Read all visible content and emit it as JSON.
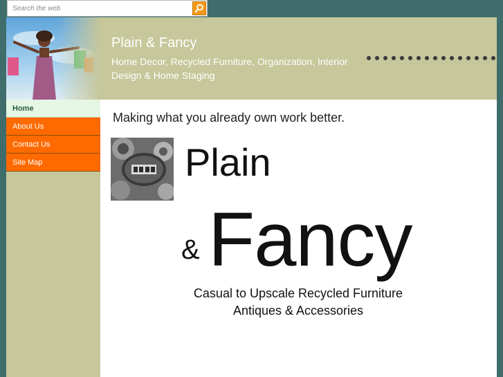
{
  "search": {
    "placeholder": "Search the web",
    "button_icon": "search-icon",
    "accent": "#f39a1a"
  },
  "header": {
    "title": "Plain & Fancy",
    "tagline": "Home Decor, Recycled Furniture, Organization, Interior Design & Home Staging",
    "background": "#c6c79a"
  },
  "sidebar": {
    "items": [
      {
        "label": "Home",
        "active": true
      },
      {
        "label": "About Us"
      },
      {
        "label": "Contact Us"
      },
      {
        "label": "Site Map"
      }
    ],
    "accent": "#ff6a00"
  },
  "main": {
    "intro": "Making what you already own work better.",
    "logo": {
      "line1": "Plain",
      "amp": "&",
      "line2": "Fancy"
    },
    "caption": {
      "line1": "Casual to Upscale Recycled Furniture",
      "line2": "Antiques & Accessories"
    }
  }
}
